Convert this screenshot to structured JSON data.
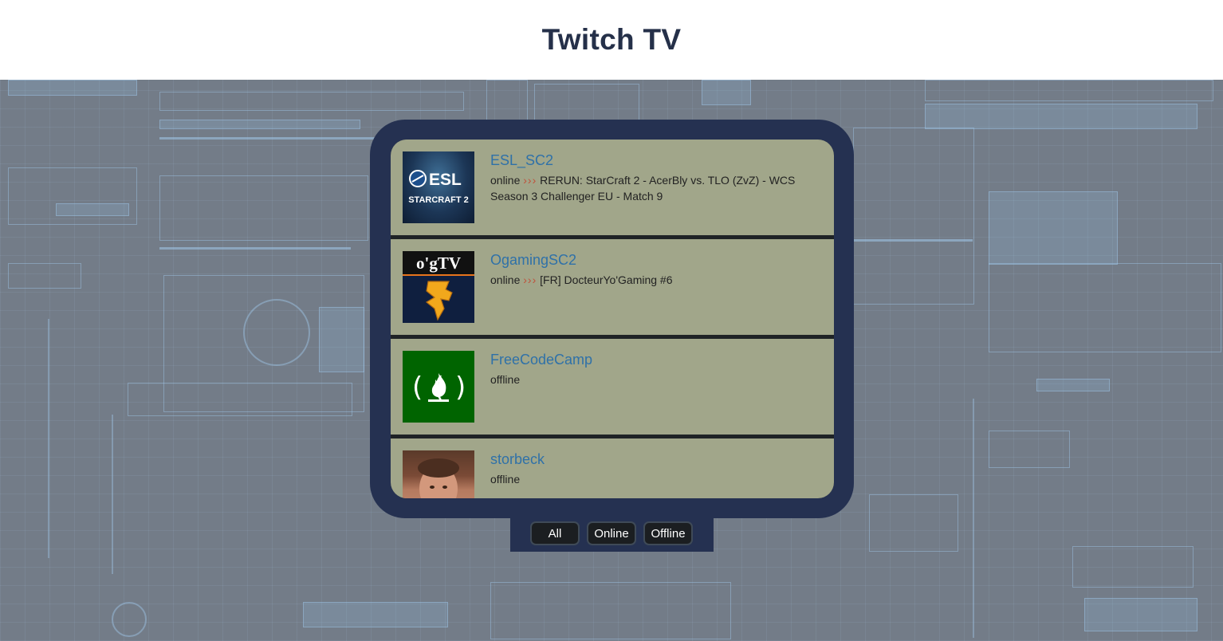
{
  "header": {
    "title": "Twitch TV"
  },
  "channels": [
    {
      "name": "ESL_SC2",
      "status": "online",
      "separator": "›››",
      "stream_title": "RERUN: StarCraft 2 - AcerBly vs. TLO (ZvZ) - WCS Season 3 Challenger EU - Match 9",
      "logo_text": {
        "brand": "ESL",
        "subtitle": "STARCRAFT 2"
      }
    },
    {
      "name": "OgamingSC2",
      "status": "online",
      "separator": "›››",
      "stream_title": "[FR] DocteurYo'Gaming #6",
      "logo_text": {
        "brand": "o'gTV"
      }
    },
    {
      "name": "FreeCodeCamp",
      "status": "offline",
      "logo_text": {
        "brand": "(🔥)"
      }
    },
    {
      "name": "storbeck",
      "status": "offline"
    }
  ],
  "filters": {
    "all": "All",
    "online": "Online",
    "offline": "Offline"
  },
  "colors": {
    "panel": "#253151",
    "item_bg": "#a1a68a",
    "link": "#2f71a8",
    "accent_arrows": "#c0503a"
  }
}
